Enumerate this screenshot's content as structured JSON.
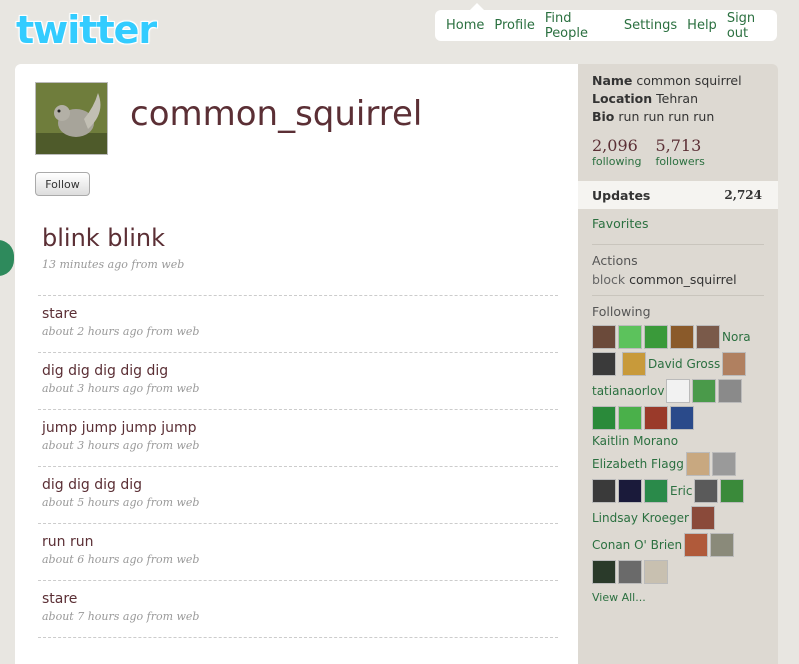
{
  "logo": {
    "text": "twitter"
  },
  "nav": {
    "items": [
      "Home",
      "Profile",
      "Find People",
      "Settings",
      "Help",
      "Sign out"
    ]
  },
  "profile": {
    "username": "common_squirrel",
    "follow_label": "Follow"
  },
  "tweets": [
    {
      "text": "blink blink",
      "meta": "13 minutes ago from web"
    },
    {
      "text": "stare",
      "meta": "about 2 hours ago from web"
    },
    {
      "text": "dig dig dig dig dig",
      "meta": "about 3 hours ago from web"
    },
    {
      "text": "jump jump jump jump",
      "meta": "about 3 hours ago from web"
    },
    {
      "text": "dig dig dig dig",
      "meta": "about 5 hours ago from web"
    },
    {
      "text": "run run",
      "meta": "about 6 hours ago from web"
    },
    {
      "text": "stare",
      "meta": "about 7 hours ago from web"
    }
  ],
  "sidebar": {
    "name_label": "Name",
    "name_value": "common squirrel",
    "location_label": "Location",
    "location_value": "Tehran",
    "bio_label": "Bio",
    "bio_value": "run run run run",
    "following_count": "2,096",
    "following_label": "following",
    "followers_count": "5,713",
    "followers_label": "followers",
    "updates_label": "Updates",
    "updates_count": "2,724",
    "favorites_label": "Favorites",
    "actions_label": "Actions",
    "block_label": "block",
    "block_name": "common_squirrel",
    "following_head": "Following",
    "following_names": [
      "Nora",
      "David Gross",
      "tatianaorlov",
      "Kaitlin Morano",
      "Elizabeth Flagg",
      "Eric",
      "Lindsay Kroeger",
      "Conan O' Brien"
    ],
    "view_all": "View All..."
  },
  "colors": {
    "accent_green": "#2b7040",
    "title_maroon": "#5b2f35",
    "logo_blue": "#33ccff"
  }
}
